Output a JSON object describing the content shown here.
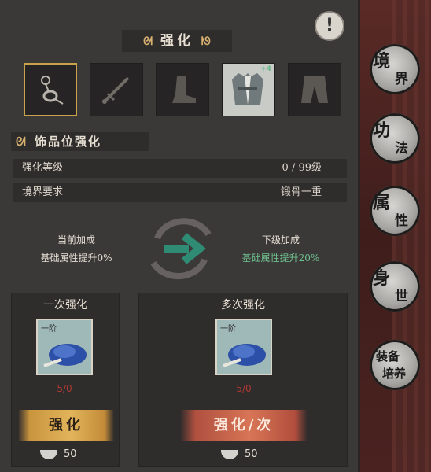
{
  "header": {
    "title": "强化",
    "alert_icon": "!"
  },
  "slots": [
    {
      "name": "ornament",
      "selected": true
    },
    {
      "name": "weapon",
      "selected": false
    },
    {
      "name": "boots",
      "selected": false
    },
    {
      "name": "armor",
      "selected": false,
      "badge": "+4"
    },
    {
      "name": "pants",
      "selected": false
    }
  ],
  "section": {
    "title": "饰品位强化"
  },
  "stats": {
    "level_label": "强化等级",
    "level_value": "0 / 99级",
    "realm_label": "境界要求",
    "realm_value": "锻骨一重"
  },
  "bonus": {
    "current_label": "当前加成",
    "current_value": "基础属性提升0%",
    "next_label": "下级加成",
    "next_value": "基础属性提升20%"
  },
  "single": {
    "title": "一次强化",
    "item_tier": "一阶",
    "count": "5/0",
    "button": "强化",
    "cost": "50"
  },
  "multi": {
    "title": "多次强化",
    "item_tier": "一阶",
    "count": "5/0",
    "button": "强化/次",
    "cost": "50"
  },
  "nav": [
    {
      "c1": "境",
      "c2": "界"
    },
    {
      "c1": "功",
      "c2": "法"
    },
    {
      "c1": "属",
      "c2": "性"
    },
    {
      "c1": "身",
      "c2": "世"
    },
    {
      "c1": "装备",
      "c2": "培养"
    }
  ],
  "colors": {
    "gold": "#c9a24c",
    "green": "#6fc38f",
    "red": "#b03a33"
  }
}
